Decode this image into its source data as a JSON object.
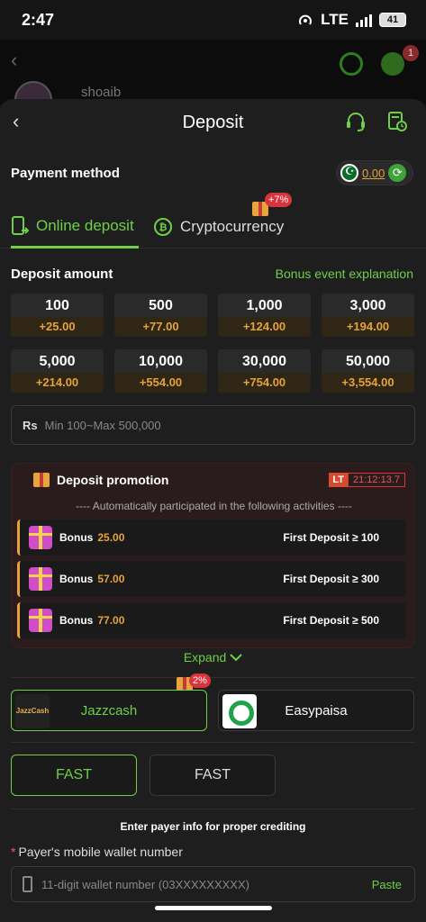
{
  "status_bar": {
    "time": "2:47",
    "network": "LTE",
    "battery": "41"
  },
  "background_page": {
    "username": "shoaib",
    "notification_count": "1"
  },
  "header": {
    "title": "Deposit"
  },
  "payment_method": {
    "label": "Payment method",
    "balance": "0.00"
  },
  "tabs": [
    {
      "label": "Online deposit",
      "active": true
    },
    {
      "label": "Cryptocurrency",
      "active": false,
      "badge": "+7%"
    }
  ],
  "deposit_amount": {
    "label": "Deposit amount",
    "bonus_link": "Bonus event explanation",
    "options": [
      {
        "value": "100",
        "bonus": "+25.00"
      },
      {
        "value": "500",
        "bonus": "+77.00"
      },
      {
        "value": "1,000",
        "bonus": "+124.00"
      },
      {
        "value": "3,000",
        "bonus": "+194.00"
      },
      {
        "value": "5,000",
        "bonus": "+214.00"
      },
      {
        "value": "10,000",
        "bonus": "+554.00"
      },
      {
        "value": "30,000",
        "bonus": "+754.00"
      },
      {
        "value": "50,000",
        "bonus": "+3,554.00"
      }
    ],
    "currency_symbol": "Rs",
    "placeholder": "Min 100~Max 500,000"
  },
  "promotion": {
    "title": "Deposit promotion",
    "timer_badge": "LT",
    "timer": "21:12:13.7",
    "subtitle": "---- Automatically participated in the following activities ----",
    "rows": [
      {
        "bonus_label": "Bonus",
        "bonus_value": "25.00",
        "condition": "First Deposit ≥ 100"
      },
      {
        "bonus_label": "Bonus",
        "bonus_value": "57.00",
        "condition": "First Deposit ≥ 300"
      },
      {
        "bonus_label": "Bonus",
        "bonus_value": "77.00",
        "condition": "First Deposit ≥ 500"
      }
    ],
    "expand_label": "Expand"
  },
  "payment_options": [
    {
      "label": "Jazzcash",
      "logo_text": "JazzCash",
      "active": true,
      "badge": "2%"
    },
    {
      "label": "Easypaisa",
      "active": false
    }
  ],
  "channels": [
    {
      "label": "FAST",
      "active": true
    },
    {
      "label": "FAST",
      "active": false
    }
  ],
  "payer": {
    "info": "Enter payer info for proper crediting",
    "required_mark": "*",
    "wallet_label": "Payer's mobile wallet number",
    "wallet_placeholder": "11-digit wallet number (03XXXXXXXXX)",
    "paste": "Paste"
  },
  "colors": {
    "accent": "#6fcf4a",
    "bonus": "#e6a23c",
    "badge": "#d8343b",
    "background": "#1e1e1e"
  }
}
